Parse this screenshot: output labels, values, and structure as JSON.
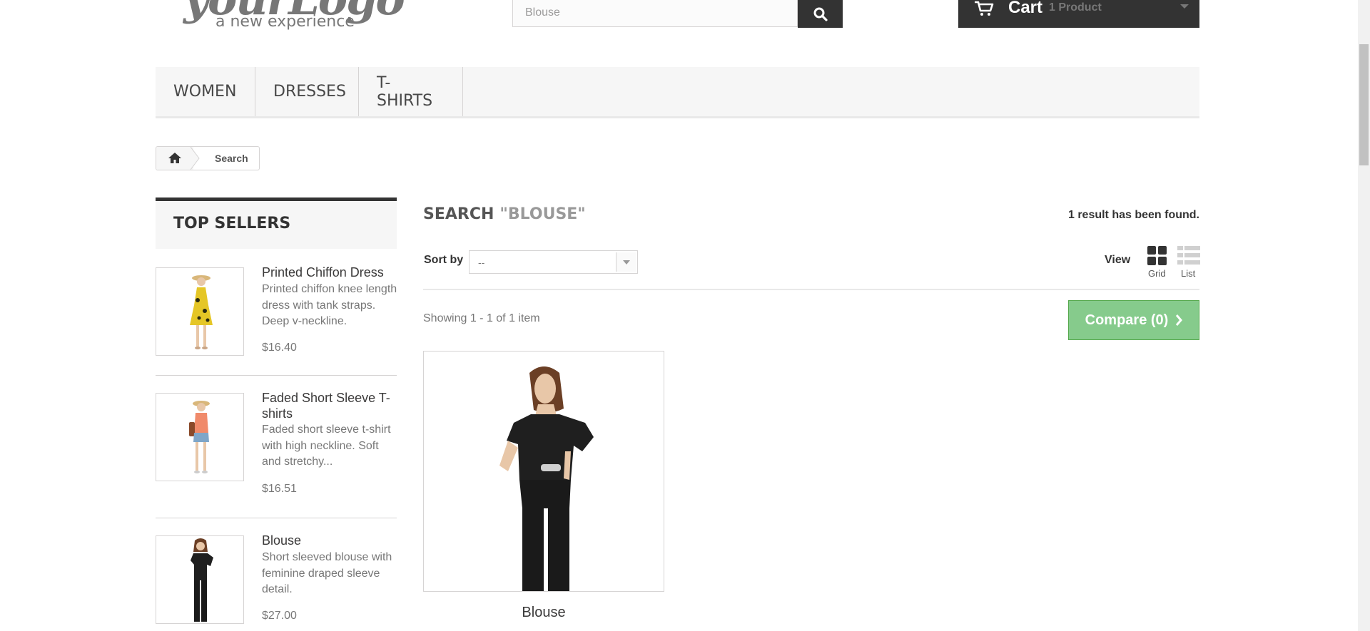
{
  "header": {
    "logo_script": "yourLogo",
    "logo_tagline": "a new experience",
    "search_value": "Blouse",
    "cart_label": "Cart",
    "cart_quantity": "1 Product"
  },
  "menu": {
    "items": [
      "WOMEN",
      "DRESSES",
      "T-SHIRTS"
    ]
  },
  "breadcrumb": {
    "current": "Search"
  },
  "top_sellers": {
    "title": "TOP SELLERS",
    "items": [
      {
        "name": "Printed Chiffon Dress",
        "description": "Printed chiffon knee length dress with tank straps. Deep v-neckline.",
        "price": "$16.40"
      },
      {
        "name": "Faded Short Sleeve T-shirts",
        "description": "Faded short sleeve t-shirt with high neckline. Soft and stretchy...",
        "price": "$16.51"
      },
      {
        "name": "Blouse",
        "description": "Short sleeved blouse with feminine draped sleeve detail.",
        "price": "$27.00"
      }
    ]
  },
  "main": {
    "title": "SEARCH",
    "query": "\"BLOUSE\"",
    "results": "1 result has been found.",
    "sort_label": "Sort by",
    "sort_value": "--",
    "view_label": "View",
    "grid_label": "Grid",
    "list_label": "List",
    "showing": "Showing 1 - 1 of 1 item",
    "compare_label": "Compare (0)",
    "product_name": "Blouse"
  },
  "colors": {
    "dark": "#333333",
    "compare_green": "#72c279"
  }
}
